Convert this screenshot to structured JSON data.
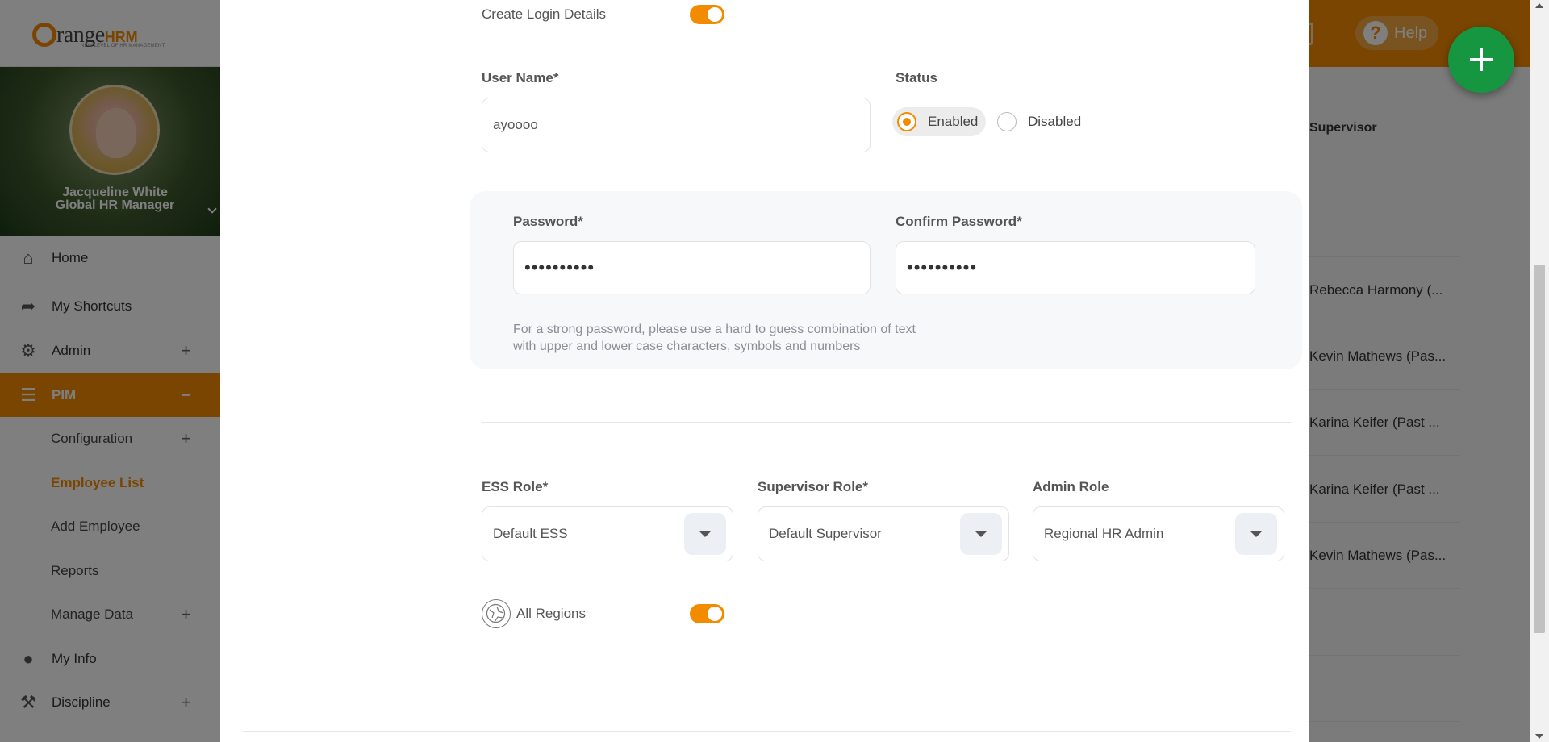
{
  "sidebar": {
    "logo": {
      "word": "range",
      "brand": "HRM",
      "tagline": "NEW LEVEL OF HR MANAGEMENT"
    },
    "profile": {
      "name": "Jacqueline White",
      "role": "Global HR Manager"
    },
    "menu": {
      "home": "Home",
      "shortcuts": "My Shortcuts",
      "admin": "Admin",
      "pim": "PIM",
      "configuration": "Configuration",
      "employee_list": "Employee List",
      "add_employee": "Add Employee",
      "reports": "Reports",
      "manage_data": "Manage Data",
      "my_info": "My Info",
      "discipline": "Discipline"
    }
  },
  "header": {
    "help": "Help"
  },
  "background_table": {
    "column": "Supervisor",
    "rows": [
      "",
      "Rebecca Harmony (...",
      "Kevin Mathews (Pas...",
      "Karina Keifer (Past ...",
      "Karina Keifer (Past ...",
      "Kevin Mathews (Pas...",
      "",
      ""
    ]
  },
  "modal": {
    "create_login": {
      "label": "Create Login Details",
      "enabled": true
    },
    "username": {
      "label": "User Name*",
      "value": "ayoooo"
    },
    "status": {
      "label": "Status",
      "options": [
        "Enabled",
        "Disabled"
      ],
      "selected": "Enabled"
    },
    "password": {
      "label": "Password*",
      "value": "••••••••••"
    },
    "confirm_password": {
      "label": "Confirm Password*",
      "value": "••••••••••"
    },
    "password_hint": {
      "line1": "For a strong password, please use a hard to guess combination of text",
      "line2": "with upper and lower case characters, symbols and numbers"
    },
    "ess_role": {
      "label": "ESS Role*",
      "value": "Default ESS"
    },
    "supervisor_role": {
      "label": "Supervisor Role*",
      "value": "Default Supervisor"
    },
    "admin_role": {
      "label": "Admin Role",
      "value": "Regional HR Admin"
    },
    "all_regions": {
      "label": "All Regions",
      "enabled": true
    }
  },
  "colors": {
    "brand": "#f28b00",
    "fab": "#169640"
  },
  "icons": [
    "home-icon",
    "shortcut-icon",
    "admin-icon",
    "pim-icon",
    "my-info-icon",
    "discipline-icon",
    "help-icon",
    "bell-icon",
    "plus-icon",
    "regions-icon",
    "dropdown-arrow-icon"
  ]
}
